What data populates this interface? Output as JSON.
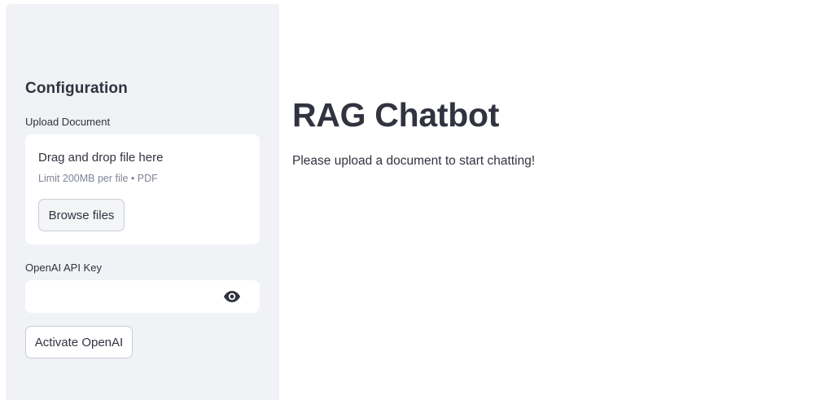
{
  "sidebar": {
    "heading": "Configuration",
    "upload": {
      "label": "Upload Document",
      "drop_text": "Drag and drop file here",
      "limit_text": "Limit 200MB per file • PDF",
      "browse_label": "Browse files"
    },
    "api_key": {
      "label": "OpenAI API Key",
      "value": "",
      "placeholder": "",
      "icon": "eye-icon"
    },
    "activate_label": "Activate OpenAI"
  },
  "main": {
    "title": "RAG Chatbot",
    "info": "Please upload a document to start chatting!"
  },
  "colors": {
    "sidebar_bg": "#f0f2f6",
    "text": "#31333f",
    "muted_text": "#808495"
  }
}
